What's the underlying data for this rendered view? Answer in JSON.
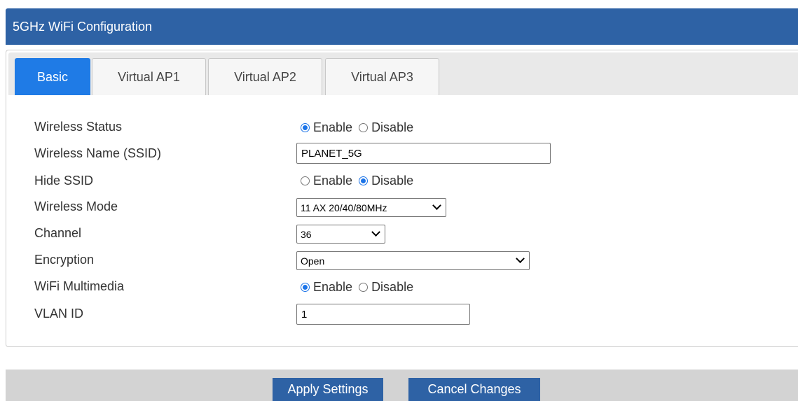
{
  "header": {
    "title": "5GHz WiFi Configuration"
  },
  "tabs": [
    {
      "label": "Basic",
      "active": true
    },
    {
      "label": "Virtual AP1",
      "active": false
    },
    {
      "label": "Virtual AP2",
      "active": false
    },
    {
      "label": "Virtual AP3",
      "active": false
    }
  ],
  "form": {
    "wireless_status": {
      "label": "Wireless Status",
      "enable_label": "Enable",
      "disable_label": "Disable",
      "selected": "Enable"
    },
    "ssid": {
      "label": "Wireless Name (SSID)",
      "value": "PLANET_5G"
    },
    "hide_ssid": {
      "label": "Hide SSID",
      "enable_label": "Enable",
      "disable_label": "Disable",
      "selected": "Disable"
    },
    "wireless_mode": {
      "label": "Wireless Mode",
      "value": "11 AX 20/40/80MHz"
    },
    "channel": {
      "label": "Channel",
      "value": "36"
    },
    "encryption": {
      "label": "Encryption",
      "value": "Open"
    },
    "wifi_multimedia": {
      "label": "WiFi Multimedia",
      "enable_label": "Enable",
      "disable_label": "Disable",
      "selected": "Enable"
    },
    "vlan_id": {
      "label": "VLAN ID",
      "value": "1"
    }
  },
  "footer": {
    "apply_label": "Apply Settings",
    "cancel_label": "Cancel Changes"
  },
  "colors": {
    "header_bg": "#2e62a5",
    "active_tab": "#1f7be6",
    "button_bg": "#2e62a5",
    "radio_accent": "#1a73e8"
  }
}
